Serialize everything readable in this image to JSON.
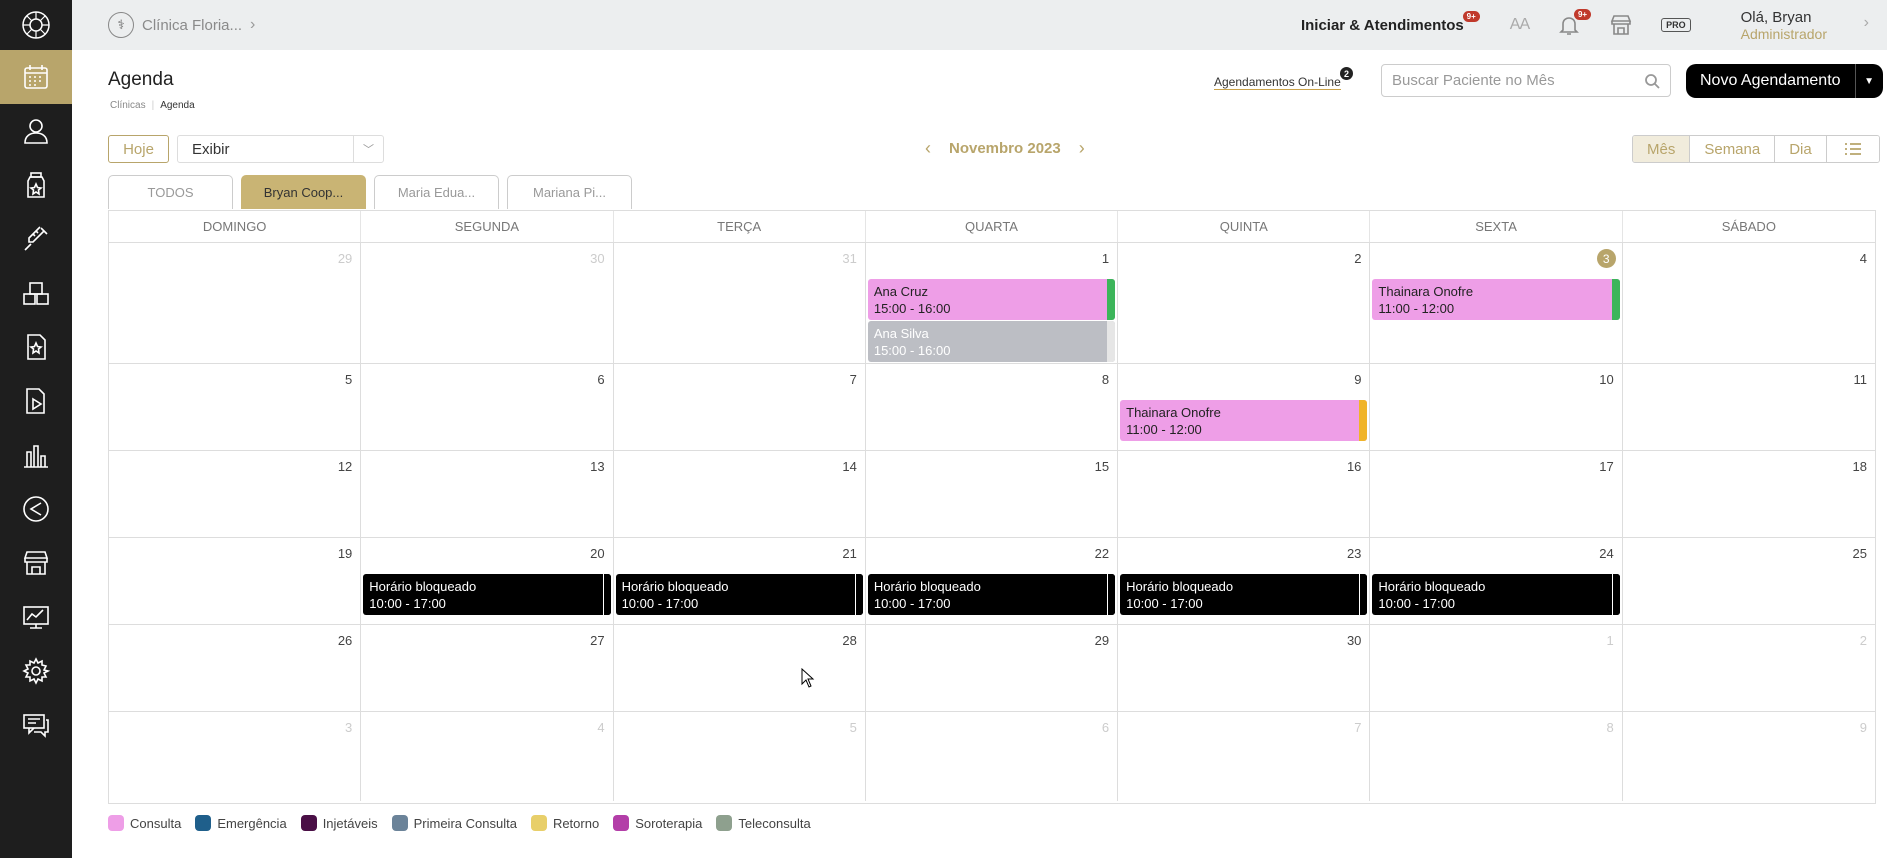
{
  "topbar": {
    "clinic_name": "Clínica Floria...",
    "iniciar_label": "Iniciar & Atendimentos",
    "iniciar_badge": "9+",
    "font_size_label": "AA",
    "notif_badge": "9+",
    "pro_label": "PRO",
    "user_greeting": "Olá, Bryan",
    "user_role": "Administrador"
  },
  "page": {
    "title": "Agenda",
    "breadcrumb": [
      "Clínicas",
      "Agenda"
    ]
  },
  "online": {
    "label": "Agendamentos On-Line",
    "count": "2"
  },
  "search": {
    "placeholder": "Buscar Paciente no Mês",
    "value": ""
  },
  "novo_button": "Novo Agendamento",
  "toolbar": {
    "hoje_label": "Hoje",
    "exibir_label": "Exibir",
    "month_label": "Novembro 2023",
    "views": [
      "Mês",
      "Semana",
      "Dia"
    ]
  },
  "prof_tabs": [
    "TODOS",
    "Bryan Coop...",
    "Maria Edua...",
    "Mariana Pi..."
  ],
  "weekdays": [
    "DOMINGO",
    "SEGUNDA",
    "TERÇA",
    "QUARTA",
    "QUINTA",
    "SEXTA",
    "SÁBADO"
  ],
  "weeks": [
    [
      "29",
      "30",
      "31",
      "1",
      "2",
      "3",
      "4"
    ],
    [
      "5",
      "6",
      "7",
      "8",
      "9",
      "10",
      "11"
    ],
    [
      "12",
      "13",
      "14",
      "15",
      "16",
      "17",
      "18"
    ],
    [
      "19",
      "20",
      "21",
      "22",
      "23",
      "24",
      "25"
    ],
    [
      "26",
      "27",
      "28",
      "29",
      "30",
      "1",
      "2"
    ],
    [
      "3",
      "4",
      "5",
      "6",
      "7",
      "8",
      "9"
    ]
  ],
  "events": [
    {
      "week": 0,
      "day": 3,
      "slot": 0,
      "name": "Ana Cruz",
      "time": "15:00 - 16:00",
      "style": "pink",
      "strip": "#3cb55a"
    },
    {
      "week": 0,
      "day": 3,
      "slot": 1,
      "name": "Ana Silva",
      "time": "15:00 - 16:00",
      "style": "gray",
      "strip": "#e6e6e6"
    },
    {
      "week": 0,
      "day": 5,
      "slot": 0,
      "name": "Thainara Onofre",
      "time": "11:00 - 12:00",
      "style": "pink",
      "strip": "#3cb55a"
    },
    {
      "week": 1,
      "day": 4,
      "slot": 0,
      "name": "Thainara Onofre",
      "time": "11:00 - 12:00",
      "style": "pink",
      "strip": "#f0b429"
    },
    {
      "week": 3,
      "day": 1,
      "slot": 0,
      "name": "Horário bloqueado",
      "time": "10:00 - 17:00",
      "style": "black",
      "strip": ""
    },
    {
      "week": 3,
      "day": 2,
      "slot": 0,
      "name": "Horário bloqueado",
      "time": "10:00 - 17:00",
      "style": "black",
      "strip": ""
    },
    {
      "week": 3,
      "day": 3,
      "slot": 0,
      "name": "Horário bloqueado",
      "time": "10:00 - 17:00",
      "style": "black",
      "strip": ""
    },
    {
      "week": 3,
      "day": 4,
      "slot": 0,
      "name": "Horário bloqueado",
      "time": "10:00 - 17:00",
      "style": "black",
      "strip": ""
    },
    {
      "week": 3,
      "day": 5,
      "slot": 0,
      "name": "Horário bloqueado",
      "time": "10:00 - 17:00",
      "style": "black",
      "strip": ""
    }
  ],
  "legend": [
    {
      "label": "Consulta",
      "color": "#ee9ee7"
    },
    {
      "label": "Emergência",
      "color": "#1f5f8b"
    },
    {
      "label": "Injetáveis",
      "color": "#4a0f46"
    },
    {
      "label": "Primeira Consulta",
      "color": "#6b8399"
    },
    {
      "label": "Retorno",
      "color": "#e8cf6a"
    },
    {
      "label": "Soroterapia",
      "color": "#b33ea8"
    },
    {
      "label": "Teleconsulta",
      "color": "#8ea08e"
    }
  ],
  "colors": {
    "accent": "#b8a56b",
    "sidebar": "#1e1e1e"
  },
  "sidebar_icons": [
    "calendar-icon",
    "user-icon",
    "medicine-icon",
    "syringe-icon",
    "boxes-icon",
    "document-star-icon",
    "document-play-icon",
    "chart-icon",
    "back-arrow-icon",
    "store-icon",
    "analytics-icon",
    "gear-icon",
    "chat-icon"
  ]
}
